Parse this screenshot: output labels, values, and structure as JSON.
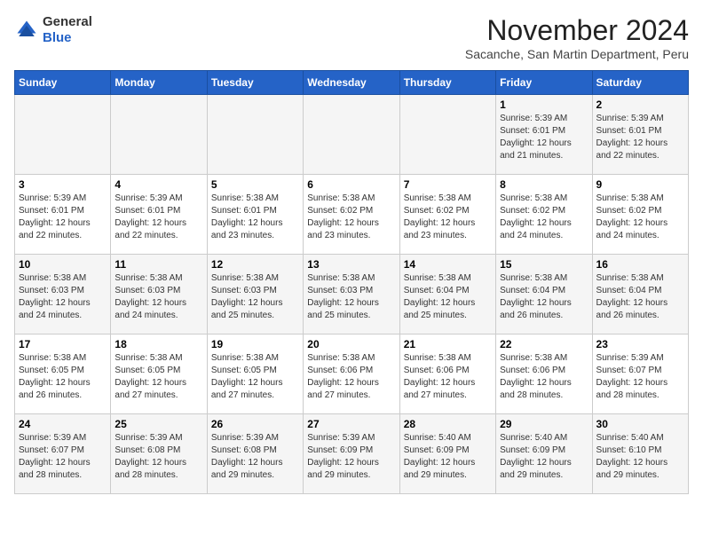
{
  "header": {
    "logo_line1": "General",
    "logo_line2": "Blue",
    "month": "November 2024",
    "location": "Sacanche, San Martin Department, Peru"
  },
  "weekdays": [
    "Sunday",
    "Monday",
    "Tuesday",
    "Wednesday",
    "Thursday",
    "Friday",
    "Saturday"
  ],
  "weeks": [
    [
      {
        "day": "",
        "info": ""
      },
      {
        "day": "",
        "info": ""
      },
      {
        "day": "",
        "info": ""
      },
      {
        "day": "",
        "info": ""
      },
      {
        "day": "",
        "info": ""
      },
      {
        "day": "1",
        "info": "Sunrise: 5:39 AM\nSunset: 6:01 PM\nDaylight: 12 hours and 21 minutes."
      },
      {
        "day": "2",
        "info": "Sunrise: 5:39 AM\nSunset: 6:01 PM\nDaylight: 12 hours and 22 minutes."
      }
    ],
    [
      {
        "day": "3",
        "info": "Sunrise: 5:39 AM\nSunset: 6:01 PM\nDaylight: 12 hours and 22 minutes."
      },
      {
        "day": "4",
        "info": "Sunrise: 5:39 AM\nSunset: 6:01 PM\nDaylight: 12 hours and 22 minutes."
      },
      {
        "day": "5",
        "info": "Sunrise: 5:38 AM\nSunset: 6:01 PM\nDaylight: 12 hours and 23 minutes."
      },
      {
        "day": "6",
        "info": "Sunrise: 5:38 AM\nSunset: 6:02 PM\nDaylight: 12 hours and 23 minutes."
      },
      {
        "day": "7",
        "info": "Sunrise: 5:38 AM\nSunset: 6:02 PM\nDaylight: 12 hours and 23 minutes."
      },
      {
        "day": "8",
        "info": "Sunrise: 5:38 AM\nSunset: 6:02 PM\nDaylight: 12 hours and 24 minutes."
      },
      {
        "day": "9",
        "info": "Sunrise: 5:38 AM\nSunset: 6:02 PM\nDaylight: 12 hours and 24 minutes."
      }
    ],
    [
      {
        "day": "10",
        "info": "Sunrise: 5:38 AM\nSunset: 6:03 PM\nDaylight: 12 hours and 24 minutes."
      },
      {
        "day": "11",
        "info": "Sunrise: 5:38 AM\nSunset: 6:03 PM\nDaylight: 12 hours and 24 minutes."
      },
      {
        "day": "12",
        "info": "Sunrise: 5:38 AM\nSunset: 6:03 PM\nDaylight: 12 hours and 25 minutes."
      },
      {
        "day": "13",
        "info": "Sunrise: 5:38 AM\nSunset: 6:03 PM\nDaylight: 12 hours and 25 minutes."
      },
      {
        "day": "14",
        "info": "Sunrise: 5:38 AM\nSunset: 6:04 PM\nDaylight: 12 hours and 25 minutes."
      },
      {
        "day": "15",
        "info": "Sunrise: 5:38 AM\nSunset: 6:04 PM\nDaylight: 12 hours and 26 minutes."
      },
      {
        "day": "16",
        "info": "Sunrise: 5:38 AM\nSunset: 6:04 PM\nDaylight: 12 hours and 26 minutes."
      }
    ],
    [
      {
        "day": "17",
        "info": "Sunrise: 5:38 AM\nSunset: 6:05 PM\nDaylight: 12 hours and 26 minutes."
      },
      {
        "day": "18",
        "info": "Sunrise: 5:38 AM\nSunset: 6:05 PM\nDaylight: 12 hours and 27 minutes."
      },
      {
        "day": "19",
        "info": "Sunrise: 5:38 AM\nSunset: 6:05 PM\nDaylight: 12 hours and 27 minutes."
      },
      {
        "day": "20",
        "info": "Sunrise: 5:38 AM\nSunset: 6:06 PM\nDaylight: 12 hours and 27 minutes."
      },
      {
        "day": "21",
        "info": "Sunrise: 5:38 AM\nSunset: 6:06 PM\nDaylight: 12 hours and 27 minutes."
      },
      {
        "day": "22",
        "info": "Sunrise: 5:38 AM\nSunset: 6:06 PM\nDaylight: 12 hours and 28 minutes."
      },
      {
        "day": "23",
        "info": "Sunrise: 5:39 AM\nSunset: 6:07 PM\nDaylight: 12 hours and 28 minutes."
      }
    ],
    [
      {
        "day": "24",
        "info": "Sunrise: 5:39 AM\nSunset: 6:07 PM\nDaylight: 12 hours and 28 minutes."
      },
      {
        "day": "25",
        "info": "Sunrise: 5:39 AM\nSunset: 6:08 PM\nDaylight: 12 hours and 28 minutes."
      },
      {
        "day": "26",
        "info": "Sunrise: 5:39 AM\nSunset: 6:08 PM\nDaylight: 12 hours and 29 minutes."
      },
      {
        "day": "27",
        "info": "Sunrise: 5:39 AM\nSunset: 6:09 PM\nDaylight: 12 hours and 29 minutes."
      },
      {
        "day": "28",
        "info": "Sunrise: 5:40 AM\nSunset: 6:09 PM\nDaylight: 12 hours and 29 minutes."
      },
      {
        "day": "29",
        "info": "Sunrise: 5:40 AM\nSunset: 6:09 PM\nDaylight: 12 hours and 29 minutes."
      },
      {
        "day": "30",
        "info": "Sunrise: 5:40 AM\nSunset: 6:10 PM\nDaylight: 12 hours and 29 minutes."
      }
    ]
  ]
}
